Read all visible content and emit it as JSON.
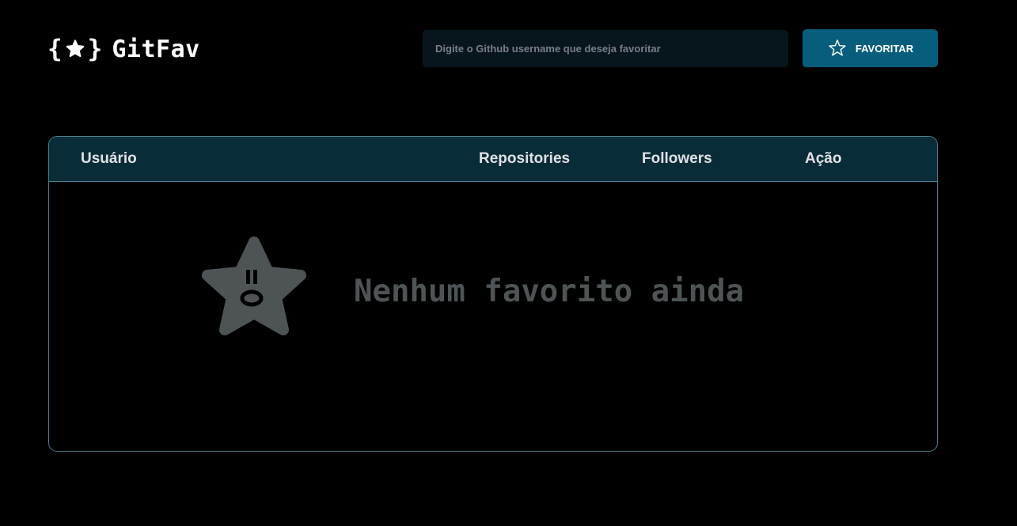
{
  "header": {
    "logo": {
      "brace_open": "{",
      "brace_close": "}",
      "icon": "star-icon",
      "title": "GitFav"
    },
    "search": {
      "placeholder": "Digite o Github username que deseja favoritar",
      "value": ""
    },
    "favorite_button": {
      "label": "Favoritar",
      "icon": "star-outline-icon"
    }
  },
  "table": {
    "columns": [
      "Usuário",
      "Repositories",
      "Followers",
      "Ação"
    ],
    "empty_state": {
      "icon": "sad-star-icon",
      "message": "Nenhum favorito ainda"
    }
  },
  "colors": {
    "background": "#000000",
    "input_background": "#06161c",
    "button": "#065e7c",
    "table_header": "#092d38",
    "border": "#4a808c",
    "muted": "#4e5455"
  }
}
